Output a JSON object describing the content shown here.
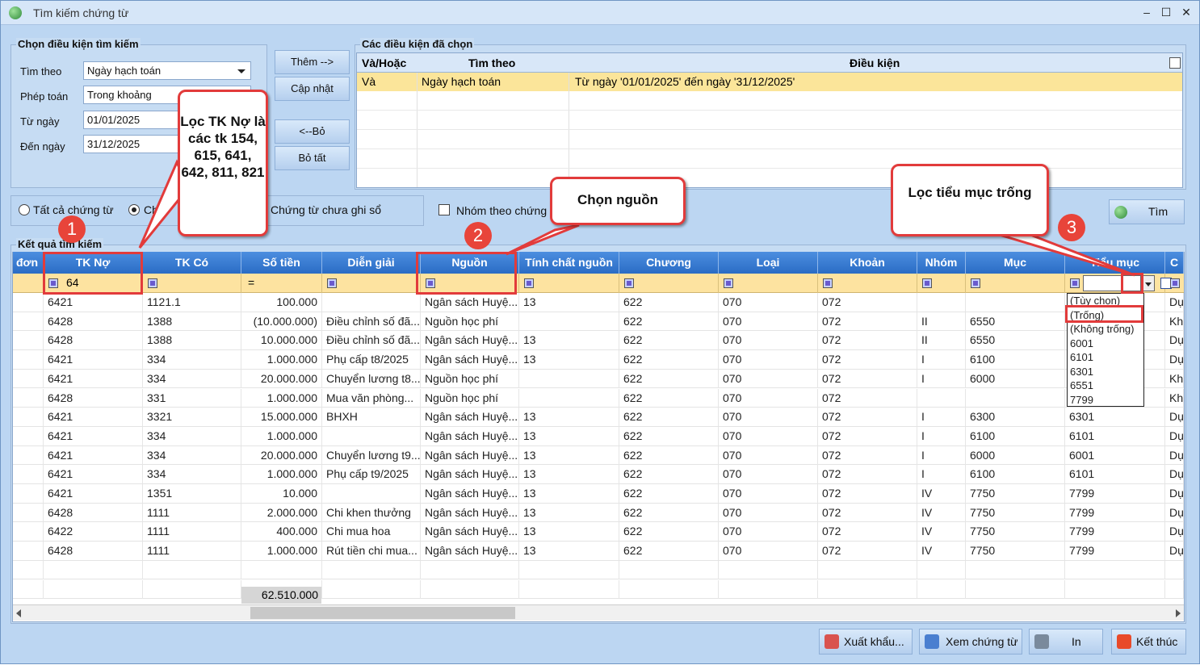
{
  "window": {
    "title": "Tìm kiếm chứng từ"
  },
  "criteria": {
    "title": "Chọn điều kiện tìm kiếm",
    "fields": [
      {
        "label": "Tìm theo",
        "value": "Ngày hạch toán"
      },
      {
        "label": "Phép toán",
        "value": "Trong khoảng"
      },
      {
        "label": "Từ ngày",
        "value": "01/01/2025"
      },
      {
        "label": "Đến ngày",
        "value": "31/12/2025"
      }
    ]
  },
  "mid_buttons": {
    "add": "Thêm -->",
    "update": "Cập nhật",
    "remove": "<--Bỏ",
    "remove_all": "Bỏ tất"
  },
  "chosen": {
    "title": "Các điều kiện đã chọn",
    "headers": [
      "Và/Hoặc",
      "Tìm theo",
      "Điều kiện"
    ],
    "rows": [
      [
        "Và",
        "Ngày hạch toán",
        "Từ ngày '01/01/2025' đến ngày '31/12/2025'"
      ]
    ]
  },
  "options": {
    "all": "Tất cả chứng từ",
    "recorded": "Ch",
    "unrecorded": "Chứng từ chưa ghi sổ",
    "group": "Nhóm theo chứng t"
  },
  "search_button": "Tìm",
  "results": {
    "title": "Kết quả tìm kiếm",
    "headers": [
      "đơn",
      "TK Nợ",
      "TK Có",
      "Số tiền",
      "Diễn giải",
      "Nguồn",
      "Tính chất nguồn",
      "Chương",
      "Loại",
      "Khoản",
      "Nhóm",
      "Mục",
      "Tiểu mục",
      "C"
    ],
    "filter": {
      "tk_no": "64",
      "so_tien_op": "="
    },
    "rows": [
      [
        "6421",
        "1121.1",
        "100.000",
        "",
        "Ngân sách Huyệ...",
        "13",
        "622",
        "070",
        "072",
        "",
        "",
        "",
        "Dự"
      ],
      [
        "6428",
        "1388",
        "(10.000.000)",
        "Điều chỉnh số đã...",
        "Nguồn học phí",
        "",
        "622",
        "070",
        "072",
        "II",
        "6550",
        "",
        "Khá"
      ],
      [
        "6428",
        "1388",
        "10.000.000",
        "Điều chỉnh số đã...",
        "Ngân sách Huyệ...",
        "13",
        "622",
        "070",
        "072",
        "II",
        "6550",
        "",
        "Dự"
      ],
      [
        "6421",
        "334",
        "1.000.000",
        "Phụ cấp t8/2025",
        "Ngân sách Huyệ...",
        "13",
        "622",
        "070",
        "072",
        "I",
        "6100",
        "",
        "Dự"
      ],
      [
        "6421",
        "334",
        "20.000.000",
        "Chuyển lương t8...",
        "Nguồn học phí",
        "",
        "622",
        "070",
        "072",
        "I",
        "6000",
        "",
        "Khá"
      ],
      [
        "6428",
        "331",
        "1.000.000",
        "Mua văn phòng...",
        "Nguồn học phí",
        "",
        "622",
        "070",
        "072",
        "",
        "",
        "",
        "Khá"
      ],
      [
        "6421",
        "3321",
        "15.000.000",
        "BHXH",
        "Ngân sách Huyệ...",
        "13",
        "622",
        "070",
        "072",
        "I",
        "6300",
        "6301",
        "Dự"
      ],
      [
        "6421",
        "334",
        "1.000.000",
        "",
        "Ngân sách Huyệ...",
        "13",
        "622",
        "070",
        "072",
        "I",
        "6100",
        "6101",
        "Dự"
      ],
      [
        "6421",
        "334",
        "20.000.000",
        "Chuyển lương t9...",
        "Ngân sách Huyệ...",
        "13",
        "622",
        "070",
        "072",
        "I",
        "6000",
        "6001",
        "Dự"
      ],
      [
        "6421",
        "334",
        "1.000.000",
        "Phụ cấp t9/2025",
        "Ngân sách Huyệ...",
        "13",
        "622",
        "070",
        "072",
        "I",
        "6100",
        "6101",
        "Dự"
      ],
      [
        "6421",
        "1351",
        "10.000",
        "",
        "Ngân sách Huyệ...",
        "13",
        "622",
        "070",
        "072",
        "IV",
        "7750",
        "7799",
        "Dự"
      ],
      [
        "6428",
        "1111",
        "2.000.000",
        "Chi khen thưởng",
        "Ngân sách Huyệ...",
        "13",
        "622",
        "070",
        "072",
        "IV",
        "7750",
        "7799",
        "Dự"
      ],
      [
        "6422",
        "1111",
        "400.000",
        "Chi mua hoa",
        "Ngân sách Huyệ...",
        "13",
        "622",
        "070",
        "072",
        "IV",
        "7750",
        "7799",
        "Dự"
      ],
      [
        "6428",
        "1111",
        "1.000.000",
        "Rút tiền chi mua...",
        "Ngân sách Huyệ...",
        "13",
        "622",
        "070",
        "072",
        "IV",
        "7750",
        "7799",
        "Dự"
      ]
    ],
    "total": "62.510.000"
  },
  "dropdown_options": [
    "(Tùy chọn)",
    "(Trống)",
    "(Không trống)",
    "6001",
    "6101",
    "6301",
    "6551",
    "7799"
  ],
  "bottom_buttons": {
    "export": "Xuất khẩu...",
    "view": "Xem chứng từ",
    "print": "In",
    "close": "Kết thúc"
  },
  "callouts": {
    "c1": "Lọc TK Nợ là các tk 154, 615, 641, 642, 811, 821",
    "c2": "Chọn nguồn",
    "c3": "Lọc tiểu mục trống",
    "b1": "1",
    "b2": "2",
    "b3": "3"
  },
  "colors": {
    "header": "#2f73cc",
    "filter_row": "#fde3a0",
    "highlight": "#fbe59a",
    "callout_border": "#e23b3b"
  }
}
